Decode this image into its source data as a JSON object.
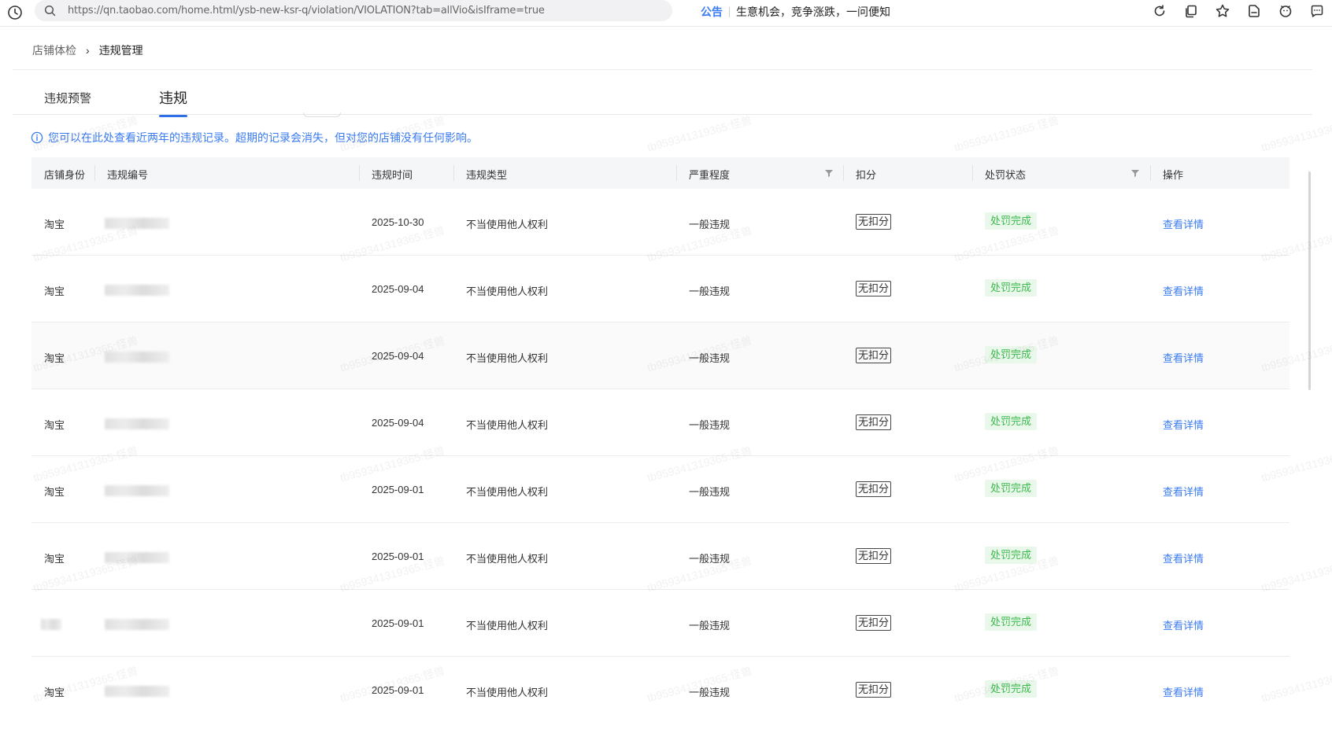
{
  "browser": {
    "url": "https://qn.taobao.com/home.html/ysb-new-ksr-q/violation/VIOLATION?tab=allVio&isIframe=true",
    "notice_tag": "公告",
    "notice_text": "生意机会，竞争涨跌，一问便知",
    "toolbar_icons": [
      "refresh-icon",
      "copy-icon",
      "star-icon",
      "bookmark-icon",
      "smile-icon",
      "chat-icon"
    ]
  },
  "breadcrumb": {
    "parent": "店铺体检",
    "separator": "›",
    "current": "违规管理"
  },
  "tabs": [
    {
      "label": "违规预警",
      "active": false
    },
    {
      "label": "违规",
      "active": true
    }
  ],
  "info": {
    "text": "您可以在此处查看近两年的违规记录。超期的记录会消失，但对您的店铺没有任何影响。"
  },
  "table": {
    "headers": {
      "role": "店铺身份",
      "id": "违规编号",
      "time": "违规时间",
      "type": "违规类型",
      "severity": "严重程度",
      "score": "扣分",
      "status": "处罚状态",
      "action": "操作"
    },
    "rows": [
      {
        "role": "淘宝",
        "time": "2025-10-30",
        "type": "不当使用他人权利",
        "severity": "一般违规",
        "score": "无扣分",
        "status": "处罚完成",
        "action": "查看详情"
      },
      {
        "role": "淘宝",
        "time": "2025-09-04",
        "type": "不当使用他人权利",
        "severity": "一般违规",
        "score": "无扣分",
        "status": "处罚完成",
        "action": "查看详情"
      },
      {
        "role": "淘宝",
        "time": "2025-09-04",
        "type": "不当使用他人权利",
        "severity": "一般违规",
        "score": "无扣分",
        "status": "处罚完成",
        "action": "查看详情"
      },
      {
        "role": "淘宝",
        "time": "2025-09-04",
        "type": "不当使用他人权利",
        "severity": "一般违规",
        "score": "无扣分",
        "status": "处罚完成",
        "action": "查看详情"
      },
      {
        "role": "淘宝",
        "time": "2025-09-01",
        "type": "不当使用他人权利",
        "severity": "一般违规",
        "score": "无扣分",
        "status": "处罚完成",
        "action": "查看详情"
      },
      {
        "role": "淘宝",
        "time": "2025-09-01",
        "type": "不当使用他人权利",
        "severity": "一般违规",
        "score": "无扣分",
        "status": "处罚完成",
        "action": "查看详情"
      },
      {
        "role": "",
        "time": "2025-09-01",
        "type": "不当使用他人权利",
        "severity": "一般违规",
        "score": "无扣分",
        "status": "处罚完成",
        "action": "查看详情"
      },
      {
        "role": "淘宝",
        "time": "2025-09-01",
        "type": "不当使用他人权利",
        "severity": "一般违规",
        "score": "无扣分",
        "status": "处罚完成",
        "action": "查看详情"
      }
    ]
  },
  "watermark": "tb959341319365:怪兽",
  "colors": {
    "accent": "#2f6fe8",
    "link": "#3a7bf0",
    "status_bg": "#e9f8ea",
    "status_text": "#3dba4e",
    "header_bg": "#f5f6f8"
  }
}
